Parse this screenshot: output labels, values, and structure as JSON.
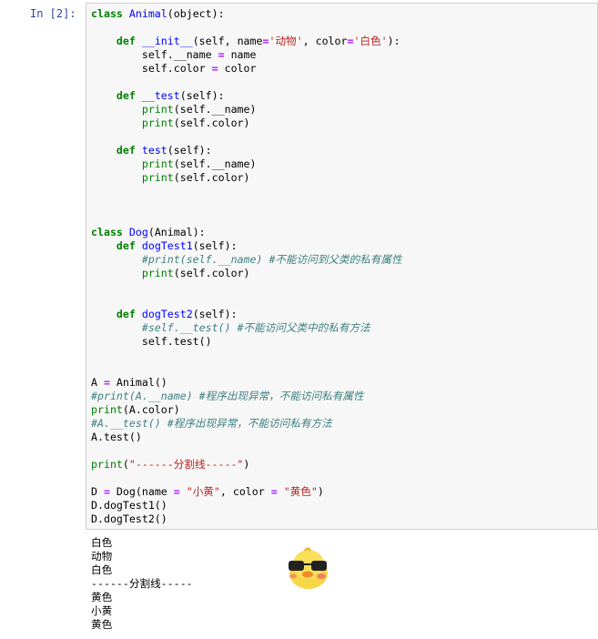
{
  "cell": {
    "prompt": "In  [2]:",
    "code_lines": [
      [
        {
          "t": "class",
          "c": "kw"
        },
        {
          "t": " "
        },
        {
          "t": "Animal",
          "c": "cls"
        },
        {
          "t": "(object):"
        }
      ],
      [
        {
          "t": ""
        }
      ],
      [
        {
          "t": "    "
        },
        {
          "t": "def",
          "c": "kw"
        },
        {
          "t": " "
        },
        {
          "t": "__init__",
          "c": "def"
        },
        {
          "t": "(self, name"
        },
        {
          "t": "=",
          "c": "op"
        },
        {
          "t": "'动物'",
          "c": "str"
        },
        {
          "t": ", color"
        },
        {
          "t": "=",
          "c": "op"
        },
        {
          "t": "'白色'",
          "c": "str"
        },
        {
          "t": "):"
        }
      ],
      [
        {
          "t": "        self.__name "
        },
        {
          "t": "=",
          "c": "op"
        },
        {
          "t": " name"
        }
      ],
      [
        {
          "t": "        self.color "
        },
        {
          "t": "=",
          "c": "op"
        },
        {
          "t": " color"
        }
      ],
      [
        {
          "t": ""
        }
      ],
      [
        {
          "t": "    "
        },
        {
          "t": "def",
          "c": "kw"
        },
        {
          "t": " "
        },
        {
          "t": "__test",
          "c": "def"
        },
        {
          "t": "(self):"
        }
      ],
      [
        {
          "t": "        "
        },
        {
          "t": "print",
          "c": "bi"
        },
        {
          "t": "(self.__name)"
        }
      ],
      [
        {
          "t": "        "
        },
        {
          "t": "print",
          "c": "bi"
        },
        {
          "t": "(self.color)"
        }
      ],
      [
        {
          "t": ""
        }
      ],
      [
        {
          "t": "    "
        },
        {
          "t": "def",
          "c": "kw"
        },
        {
          "t": " "
        },
        {
          "t": "test",
          "c": "def"
        },
        {
          "t": "(self):"
        }
      ],
      [
        {
          "t": "        "
        },
        {
          "t": "print",
          "c": "bi"
        },
        {
          "t": "(self.__name)"
        }
      ],
      [
        {
          "t": "        "
        },
        {
          "t": "print",
          "c": "bi"
        },
        {
          "t": "(self.color)"
        }
      ],
      [
        {
          "t": ""
        }
      ],
      [
        {
          "t": ""
        }
      ],
      [
        {
          "t": ""
        }
      ],
      [
        {
          "t": "class",
          "c": "kw"
        },
        {
          "t": " "
        },
        {
          "t": "Dog",
          "c": "cls"
        },
        {
          "t": "(Animal):"
        }
      ],
      [
        {
          "t": "    "
        },
        {
          "t": "def",
          "c": "kw"
        },
        {
          "t": " "
        },
        {
          "t": "dogTest1",
          "c": "def"
        },
        {
          "t": "(self):"
        }
      ],
      [
        {
          "t": "        "
        },
        {
          "t": "#print(self.__name) #不能访问到父类的私有属性",
          "c": "cmt"
        }
      ],
      [
        {
          "t": "        "
        },
        {
          "t": "print",
          "c": "bi"
        },
        {
          "t": "(self.color)"
        }
      ],
      [
        {
          "t": ""
        }
      ],
      [
        {
          "t": ""
        }
      ],
      [
        {
          "t": "    "
        },
        {
          "t": "def",
          "c": "kw"
        },
        {
          "t": " "
        },
        {
          "t": "dogTest2",
          "c": "def"
        },
        {
          "t": "(self):"
        }
      ],
      [
        {
          "t": "        "
        },
        {
          "t": "#self.__test() #不能访问父类中的私有方法",
          "c": "cmt"
        }
      ],
      [
        {
          "t": "        self.test()"
        }
      ],
      [
        {
          "t": ""
        }
      ],
      [
        {
          "t": ""
        }
      ],
      [
        {
          "t": "A "
        },
        {
          "t": "=",
          "c": "op"
        },
        {
          "t": " Animal()"
        }
      ],
      [
        {
          "t": "#print(A.__name) #程序出现异常，不能访问私有属性",
          "c": "cmt"
        }
      ],
      [
        {
          "t": "print",
          "c": "bi"
        },
        {
          "t": "(A.color)"
        }
      ],
      [
        {
          "t": "#A.__test() #程序出现异常，不能访问私有方法",
          "c": "cmt"
        }
      ],
      [
        {
          "t": "A.test()"
        }
      ],
      [
        {
          "t": ""
        }
      ],
      [
        {
          "t": "print",
          "c": "bi"
        },
        {
          "t": "("
        },
        {
          "t": "\"------分割线-----\"",
          "c": "str"
        },
        {
          "t": ")"
        }
      ],
      [
        {
          "t": ""
        }
      ],
      [
        {
          "t": "D "
        },
        {
          "t": "=",
          "c": "op"
        },
        {
          "t": " Dog(name "
        },
        {
          "t": "=",
          "c": "op"
        },
        {
          "t": " "
        },
        {
          "t": "\"小黄\"",
          "c": "str"
        },
        {
          "t": ", color "
        },
        {
          "t": "=",
          "c": "op"
        },
        {
          "t": " "
        },
        {
          "t": "\"黄色\"",
          "c": "str"
        },
        {
          "t": ")"
        }
      ],
      [
        {
          "t": "D.dogTest1()"
        }
      ],
      [
        {
          "t": "D.dogTest2()"
        }
      ]
    ],
    "output_lines": [
      "白色",
      "动物",
      "白色",
      "------分割线-----",
      "黄色",
      "小黄",
      "黄色"
    ]
  },
  "sticker": {
    "icon": "duck-sticker-icon"
  },
  "colors": {
    "keyword": "#008000",
    "name": "#0000ff",
    "string": "#ba2121",
    "comment": "#408080",
    "operator": "#aa22ff",
    "prompt": "#303F9F"
  }
}
